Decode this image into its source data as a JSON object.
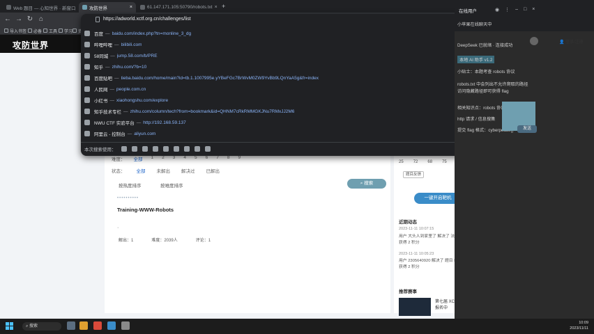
{
  "browser": {
    "tabs": [
      {
        "label": "Web 题目 — 心知世界 · 新窗口"
      },
      {
        "label": "攻防世界"
      },
      {
        "label": "61.147.171.105:50790/robots.txt"
      }
    ],
    "bookmarks": [
      {
        "label": "导入书签"
      },
      {
        "label": "必备"
      },
      {
        "label": "工具"
      },
      {
        "label": "学习"
      },
      {
        "label": "资源"
      },
      {
        "label": "CTF"
      },
      {
        "label": "安全"
      }
    ]
  },
  "omnibox": {
    "url": "https://adworld.xctf.org.cn/challenges/list",
    "suggestions": [
      {
        "title": "百度",
        "url": "baidu.com/index.php?tn=monline_3_dg"
      },
      {
        "title": "哔哩哔哩",
        "url": "bilibili.com"
      },
      {
        "title": "58同城",
        "url": "jump.58.com/b/PRE"
      },
      {
        "title": "知乎",
        "url": "zhihu.com/?b=10"
      },
      {
        "title": "百度贴吧",
        "url": "tieba.baidu.com/home/main?id=tb.1.1007995e.yYBeFGc7BrWvM0ZW9YvBb9LQnYaA5g&fr=index"
      },
      {
        "title": "人民网",
        "url": "people.com.cn"
      },
      {
        "title": "小红书",
        "url": "xiaohongshu.com/explore"
      },
      {
        "title": "知乎技术专栏",
        "url": "zhihu.com/column/tech?from=bookmark&id=QHNM7cRkRMMGKJNu7RMxJJ2M6"
      },
      {
        "title": "NWU CTF 实验平台",
        "url": "http://192.168.59.137"
      },
      {
        "title": "阿里云 - 控制台",
        "url": "aliyun.com"
      }
    ],
    "shortcut_label": "本次搜索使用："
  },
  "site": {
    "logo": "攻防世界",
    "filters": {
      "row1_label": "难度：",
      "row1_items": [
        "全部",
        "1",
        "2",
        "3",
        "4",
        "5",
        "6",
        "7",
        "8",
        "9",
        "10"
      ],
      "row2_label": "状态：",
      "row2_items": [
        "全部",
        "未解出",
        "解决过",
        "已解出"
      ],
      "sort_label": "按热度排序",
      "sort2_label": "按难度排序",
      "search_label": "搜索"
    },
    "challenge": {
      "dots": "••••••••••",
      "title": "Training-WWW-Robots",
      "desc": "·",
      "stats": [
        "解出：1",
        "难度：2039人",
        "评论：1"
      ]
    },
    "right": {
      "nums": [
        "25",
        "72",
        "68",
        "75"
      ],
      "report_label": "题目反馈",
      "cta_label": "一键开启靶机",
      "news_title": "近期动态",
      "news": [
        {
          "time": "2023-11-11 10:07:15",
          "text": "用户 大头人到家里了 解决了 法律 Warmup 题目，获得 2 积分"
        },
        {
          "time": "2023-11-11 10:05:23",
          "text": "用户 2305640920 解决了 题目 Hello JWT 题目，获得 2 积分"
        }
      ],
      "rec_title": "推荐赛事",
      "rec_item": "第七届 XCTF 国际联赛 火热报名中"
    }
  },
  "panel": {
    "title": "在线用户",
    "lines": [
      "小苹果在线聊天中",
      "DeepSeek 已就绪 · 连接成功",
      "本地 AI 助手 v1.2",
      "小贴士：本题考查 robots 协议",
      "robots.txt 中会列出不允许爬取的路径",
      "访问隐藏路径即可获得 flag",
      "相关知识点：robots 协议",
      "http 请求 / 信息搜集",
      "提交 flag 格式：cyberpeace{}"
    ],
    "btn": "发送",
    "login": "登录/注册"
  },
  "taskbar": {
    "search": "搜索",
    "time": "10:09",
    "date": "2023/11/11"
  },
  "colors": {
    "accent_teal": "#6f9fb0",
    "cta_blue": "#3a8cc8",
    "dark_bg": "#202124"
  }
}
